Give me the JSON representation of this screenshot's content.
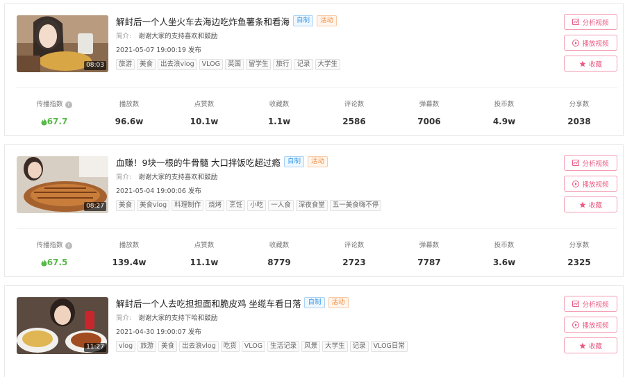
{
  "labels": {
    "intro_label": "简介:",
    "published_suffix": "发布",
    "actions": {
      "analyze": "分析视频",
      "play": "播放视频",
      "favorite": "收藏"
    },
    "stats": [
      "传播指数",
      "播放数",
      "点赞数",
      "收藏数",
      "评论数",
      "弹幕数",
      "投币数",
      "分享数"
    ]
  },
  "colors": {
    "accent_pink": "#ec5b83",
    "index_green": "#59b94a",
    "badge_blue": "#3b9be8",
    "badge_orange": "#f08a3c"
  },
  "videos": [
    {
      "title": "解封后一个人坐火车去海边吃炸鱼薯条和看海",
      "badges": [
        "自制",
        "活动"
      ],
      "intro": "谢谢大家的支持喜欢和鼓励",
      "published": "2021-05-07 19:00:19 发布",
      "duration": "08:03",
      "tags": [
        "旅游",
        "美食",
        "出去浪vlog",
        "VLOG",
        "英国",
        "留学生",
        "旅行",
        "记录",
        "大学生"
      ],
      "stats": {
        "index": "67.7",
        "plays": "96.6w",
        "likes": "10.1w",
        "favorites": "1.1w",
        "comments": "2586",
        "danmaku": "7006",
        "coins": "4.9w",
        "shares": "2038"
      }
    },
    {
      "title": "血赚！9块一根的牛骨髓 大口拌饭吃超过瘾",
      "badges": [
        "自制",
        "活动"
      ],
      "intro": "谢谢大家的支持喜欢和鼓励",
      "published": "2021-05-04 19:00:06 发布",
      "duration": "08:27",
      "tags": [
        "美食",
        "美食vlog",
        "料理制作",
        "烧烤",
        "烹饪",
        "小吃",
        "一人食",
        "深夜食堂",
        "五一美食嗨不停"
      ],
      "stats": {
        "index": "67.5",
        "plays": "139.4w",
        "likes": "11.1w",
        "favorites": "8779",
        "comments": "2723",
        "danmaku": "7787",
        "coins": "3.6w",
        "shares": "2325"
      }
    },
    {
      "title": "解封后一个人去吃担担面和脆皮鸡 坐缆车看日落",
      "badges": [
        "自制",
        "活动"
      ],
      "intro": "谢谢大家的支持下哈和鼓励",
      "published": "2021-04-30 19:00:07 发布",
      "duration": "11:27",
      "tags": [
        "vlog",
        "旅游",
        "美食",
        "出去浪vlog",
        "吃货",
        "VLOG",
        "生活记录",
        "风景",
        "大学生",
        "记录",
        "VLOG日常"
      ]
    }
  ]
}
